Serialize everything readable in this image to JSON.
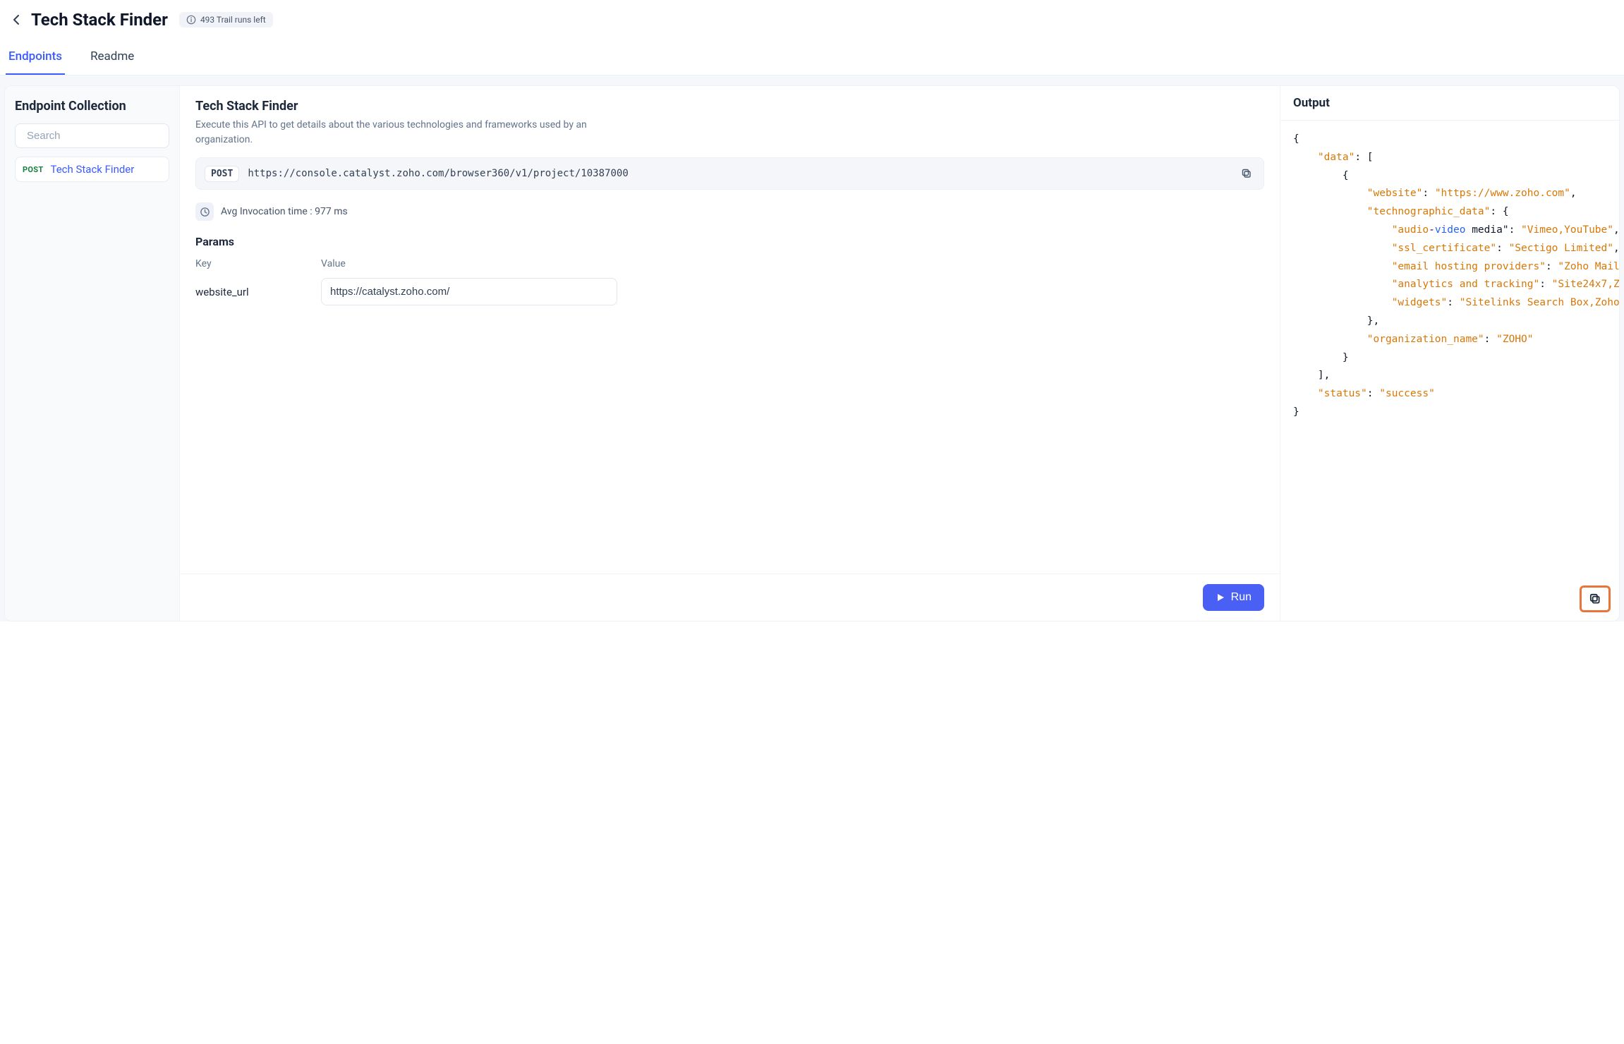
{
  "header": {
    "title": "Tech Stack Finder",
    "trail_runs": "493 Trail runs left"
  },
  "tabs": {
    "endpoints": "Endpoints",
    "readme": "Readme"
  },
  "sidebar": {
    "heading": "Endpoint Collection",
    "search_placeholder": "Search",
    "items": [
      {
        "method": "POST",
        "name": "Tech Stack Finder"
      }
    ]
  },
  "center": {
    "title": "Tech Stack Finder",
    "description": "Execute this API to get details about the various technologies and frameworks used by an organization.",
    "method": "POST",
    "url": "https://console.catalyst.zoho.com/browser360/v1/project/10387000",
    "avg_label": "Avg Invocation time : 977 ms",
    "params_heading": "Params",
    "key_header": "Key",
    "value_header": "Value",
    "param_key": "website_url",
    "param_value": "https://catalyst.zoho.com/",
    "run_label": "Run"
  },
  "output": {
    "heading": "Output",
    "lines": [
      [
        [
          "p",
          "{"
        ]
      ],
      [
        [
          "p",
          "    "
        ],
        [
          "k",
          "\"data\""
        ],
        [
          "p",
          ": ["
        ]
      ],
      [
        [
          "p",
          "        {"
        ]
      ],
      [
        [
          "p",
          "            "
        ],
        [
          "k",
          "\"website\""
        ],
        [
          "p",
          ": "
        ],
        [
          "s",
          "\"https://www.zoho.com\""
        ],
        [
          "p",
          ","
        ]
      ],
      [
        [
          "p",
          "            "
        ],
        [
          "k",
          "\"technographic_data\""
        ],
        [
          "p",
          ": {"
        ]
      ],
      [
        [
          "p",
          "                "
        ],
        [
          "k",
          "\"audio"
        ],
        [
          "p",
          "-"
        ],
        [
          "b",
          "video"
        ],
        [
          "n",
          " media\""
        ],
        [
          "p",
          ": "
        ],
        [
          "s",
          "\"Vimeo,YouTube\""
        ],
        [
          "p",
          ","
        ]
      ],
      [
        [
          "p",
          "                "
        ],
        [
          "k",
          "\"ssl_certificate\""
        ],
        [
          "p",
          ": "
        ],
        [
          "s",
          "\"Sectigo Limited\""
        ],
        [
          "p",
          ","
        ]
      ],
      [
        [
          "p",
          "                "
        ],
        [
          "k",
          "\"email hosting providers\""
        ],
        [
          "p",
          ": "
        ],
        [
          "s",
          "\"Zoho Mail\""
        ]
      ],
      [
        [
          "p",
          "                "
        ],
        [
          "k",
          "\"analytics and tracking\""
        ],
        [
          "p",
          ": "
        ],
        [
          "s",
          "\"Site24x7,Z\""
        ]
      ],
      [
        [
          "p",
          "                "
        ],
        [
          "k",
          "\"widgets\""
        ],
        [
          "p",
          ": "
        ],
        [
          "s",
          "\"Sitelinks Search Box,Zoho\""
        ]
      ],
      [
        [
          "p",
          "            },"
        ]
      ],
      [
        [
          "p",
          "            "
        ],
        [
          "k",
          "\"organization_name\""
        ],
        [
          "p",
          ": "
        ],
        [
          "s",
          "\"ZOHO\""
        ]
      ],
      [
        [
          "p",
          "        }"
        ]
      ],
      [
        [
          "p",
          "    ],"
        ]
      ],
      [
        [
          "p",
          "    "
        ],
        [
          "k",
          "\"status\""
        ],
        [
          "p",
          ": "
        ],
        [
          "s",
          "\"success\""
        ]
      ],
      [
        [
          "p",
          "}"
        ]
      ]
    ]
  }
}
